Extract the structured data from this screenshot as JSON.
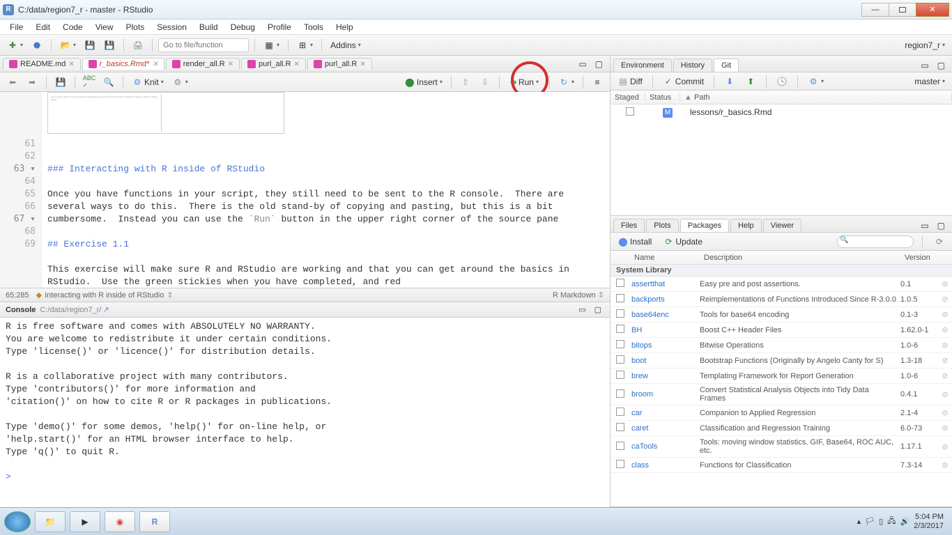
{
  "window": {
    "title": "C:/data/region7_r - master - RStudio"
  },
  "menu": [
    "File",
    "Edit",
    "Code",
    "View",
    "Plots",
    "Session",
    "Build",
    "Debug",
    "Profile",
    "Tools",
    "Help"
  ],
  "toolbar": {
    "goto_placeholder": "Go to file/function",
    "addins": "Addins",
    "project": "region7_r"
  },
  "source": {
    "tabs": [
      {
        "label": "README.md",
        "active": false
      },
      {
        "label": "r_basics.Rmd*",
        "active": true
      },
      {
        "label": "render_all.R",
        "active": false
      },
      {
        "label": "purl_all.R",
        "active": false
      },
      {
        "label": "purl_all.R",
        "active": false
      }
    ],
    "toolbar": {
      "knit": "Knit",
      "insert": "Insert",
      "run": "Run"
    },
    "lines": [
      {
        "n": "61",
        "t": ""
      },
      {
        "n": "62",
        "t": ""
      },
      {
        "n": "63",
        "t": "### Interacting with R inside of RStudio",
        "cls": "hd",
        "fold": true
      },
      {
        "n": "64",
        "t": ""
      },
      {
        "n": "65",
        "t": "Once you have functions in your script, they still need to be sent to the R console.  There are several ways to do this.  There is the old stand-by of copying and pasting, but this is a bit cumbersome.  Instead you can use the `Run` button in the upper right corner of the source pane"
      },
      {
        "n": "66",
        "t": ""
      },
      {
        "n": "67",
        "t": "## Exercise 1.1",
        "cls": "hd",
        "fold": true
      },
      {
        "n": "68",
        "t": ""
      },
      {
        "n": "69",
        "t": "This exercise will make sure R and RStudio are working and that you can get around the basics in RStudio.  Use the green stickies when you have completed, and red"
      }
    ],
    "status": {
      "pos": "65:285",
      "section": "Interacting with R inside of RStudio",
      "mode": "R Markdown"
    }
  },
  "console": {
    "label": "Console",
    "path": "C:/data/region7_r/",
    "lines": [
      "R is free software and comes with ABSOLUTELY NO WARRANTY.",
      "You are welcome to redistribute it under certain conditions.",
      "Type 'license()' or 'licence()' for distribution details.",
      "",
      "R is a collaborative project with many contributors.",
      "Type 'contributors()' for more information and",
      "'citation()' on how to cite R or R packages in publications.",
      "",
      "Type 'demo()' for some demos, 'help()' for on-line help, or",
      "'help.start()' for an HTML browser interface to help.",
      "Type 'q()' to quit R.",
      ""
    ],
    "prompt": ">"
  },
  "right_top": {
    "tabs": [
      "Environment",
      "History",
      "Git"
    ],
    "active": "Git",
    "git": {
      "diff": "Diff",
      "commit": "Commit",
      "branch": "master",
      "cols": {
        "staged": "Staged",
        "status": "Status",
        "path": "Path"
      },
      "file": {
        "status": "M",
        "path": "lessons/r_basics.Rmd"
      }
    }
  },
  "right_bottom": {
    "tabs": [
      "Files",
      "Plots",
      "Packages",
      "Help",
      "Viewer"
    ],
    "active": "Packages",
    "install": "Install",
    "update": "Update",
    "cols": {
      "name": "Name",
      "desc": "Description",
      "ver": "Version"
    },
    "section": "System Library",
    "packages": [
      {
        "n": "assertthat",
        "d": "Easy pre and post assertions.",
        "v": "0.1"
      },
      {
        "n": "backports",
        "d": "Reimplementations of Functions Introduced Since R-3.0.0",
        "v": "1.0.5"
      },
      {
        "n": "base64enc",
        "d": "Tools for base64 encoding",
        "v": "0.1-3"
      },
      {
        "n": "BH",
        "d": "Boost C++ Header Files",
        "v": "1.62.0-1"
      },
      {
        "n": "bitops",
        "d": "Bitwise Operations",
        "v": "1.0-6"
      },
      {
        "n": "boot",
        "d": "Bootstrap Functions (Originally by Angelo Canty for S)",
        "v": "1.3-18"
      },
      {
        "n": "brew",
        "d": "Templating Framework for Report Generation",
        "v": "1.0-6"
      },
      {
        "n": "broom",
        "d": "Convert Statistical Analysis Objects into Tidy Data Frames",
        "v": "0.4.1"
      },
      {
        "n": "car",
        "d": "Companion to Applied Regression",
        "v": "2.1-4"
      },
      {
        "n": "caret",
        "d": "Classification and Regression Training",
        "v": "6.0-73"
      },
      {
        "n": "caTools",
        "d": "Tools: moving window statistics, GIF, Base64, ROC AUC, etc.",
        "v": "1.17.1"
      },
      {
        "n": "class",
        "d": "Functions for Classification",
        "v": "7.3-14"
      }
    ]
  },
  "taskbar": {
    "time": "5:04 PM",
    "date": "2/3/2017"
  }
}
